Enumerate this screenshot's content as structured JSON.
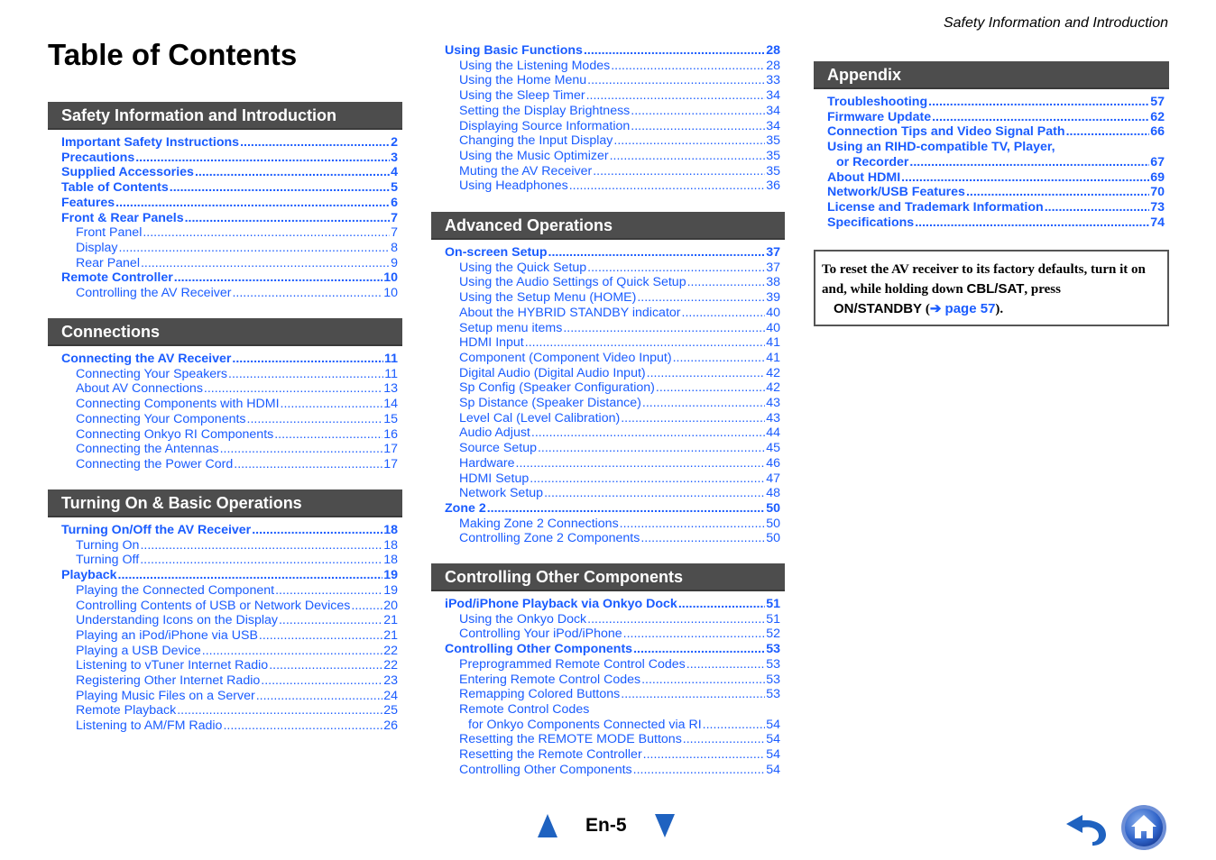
{
  "running_head": "Safety Information and Introduction",
  "page_title": "Table of Contents",
  "sections": [
    {
      "title": "Safety Information and Introduction",
      "items": [
        {
          "level": 1,
          "label": "Important Safety Instructions",
          "page": "2"
        },
        {
          "level": 1,
          "label": "Precautions",
          "page": "3"
        },
        {
          "level": 1,
          "label": "Supplied Accessories",
          "page": "4"
        },
        {
          "level": 1,
          "label": "Table of Contents",
          "page": "5"
        },
        {
          "level": 1,
          "label": "Features",
          "page": "6"
        },
        {
          "level": 1,
          "label": "Front & Rear Panels",
          "page": "7"
        },
        {
          "level": 2,
          "label": "Front Panel",
          "page": "7"
        },
        {
          "level": 2,
          "label": "Display",
          "page": "8"
        },
        {
          "level": 2,
          "label": "Rear Panel",
          "page": "9"
        },
        {
          "level": 1,
          "label": "Remote Controller",
          "page": "10"
        },
        {
          "level": 2,
          "label": "Controlling the AV Receiver",
          "page": "10"
        }
      ]
    },
    {
      "title": "Connections",
      "items": [
        {
          "level": 1,
          "label": "Connecting the AV Receiver",
          "page": "11"
        },
        {
          "level": 2,
          "label": "Connecting Your Speakers",
          "page": "11"
        },
        {
          "level": 2,
          "label": "About AV Connections",
          "page": "13"
        },
        {
          "level": 2,
          "label": "Connecting Components with HDMI",
          "page": "14"
        },
        {
          "level": 2,
          "label": "Connecting Your Components",
          "page": "15"
        },
        {
          "level": 2,
          "label": "Connecting Onkyo RI Components",
          "page": "16"
        },
        {
          "level": 2,
          "label": "Connecting the Antennas",
          "page": "17"
        },
        {
          "level": 2,
          "label": "Connecting the Power Cord",
          "page": "17"
        }
      ]
    },
    {
      "title": "Turning On & Basic Operations",
      "items": [
        {
          "level": 1,
          "label": "Turning On/Off the AV Receiver",
          "page": "18"
        },
        {
          "level": 2,
          "label": "Turning On",
          "page": "18"
        },
        {
          "level": 2,
          "label": "Turning Off",
          "page": "18"
        },
        {
          "level": 1,
          "label": "Playback",
          "page": "19"
        },
        {
          "level": 2,
          "label": "Playing the Connected Component",
          "page": "19"
        },
        {
          "level": 2,
          "label": "Controlling Contents of USB or Network Devices",
          "page": "20"
        },
        {
          "level": 2,
          "label": "Understanding Icons on the Display",
          "page": "21"
        },
        {
          "level": 2,
          "label": "Playing an iPod/iPhone via USB",
          "page": "21"
        },
        {
          "level": 2,
          "label": "Playing a USB Device",
          "page": "22"
        },
        {
          "level": 2,
          "label": "Listening to vTuner Internet Radio",
          "page": "22"
        },
        {
          "level": 2,
          "label": "Registering Other Internet Radio",
          "page": "23"
        },
        {
          "level": 2,
          "label": "Playing Music Files on a Server",
          "page": "24"
        },
        {
          "level": 2,
          "label": "Remote Playback",
          "page": "25"
        },
        {
          "level": 2,
          "label": "Listening to AM/FM Radio",
          "page": "26"
        }
      ]
    },
    {
      "title": "",
      "items": [
        {
          "level": 1,
          "label": "Using Basic Functions",
          "page": "28"
        },
        {
          "level": 2,
          "label": "Using the Listening Modes",
          "page": "28"
        },
        {
          "level": 2,
          "label": "Using the Home Menu",
          "page": "33"
        },
        {
          "level": 2,
          "label": "Using the Sleep Timer",
          "page": "34"
        },
        {
          "level": 2,
          "label": "Setting the Display Brightness",
          "page": "34"
        },
        {
          "level": 2,
          "label": "Displaying Source Information",
          "page": "34"
        },
        {
          "level": 2,
          "label": "Changing the Input Display",
          "page": "35"
        },
        {
          "level": 2,
          "label": "Using the Music Optimizer",
          "page": "35"
        },
        {
          "level": 2,
          "label": "Muting the AV Receiver",
          "page": "35"
        },
        {
          "level": 2,
          "label": "Using Headphones",
          "page": "36"
        }
      ]
    },
    {
      "title": "Advanced Operations",
      "items": [
        {
          "level": 1,
          "label": "On-screen Setup",
          "page": "37"
        },
        {
          "level": 2,
          "label": "Using the Quick Setup",
          "page": "37"
        },
        {
          "level": 2,
          "label": "Using the Audio Settings of Quick Setup",
          "page": "38"
        },
        {
          "level": 2,
          "label": "Using the Setup Menu (HOME)",
          "page": "39"
        },
        {
          "level": 2,
          "label": "About the HYBRID STANDBY indicator",
          "page": "40"
        },
        {
          "level": 2,
          "label": "Setup menu items",
          "page": "40"
        },
        {
          "level": 2,
          "label": "HDMI Input",
          "page": "41"
        },
        {
          "level": 2,
          "label": "Component (Component Video Input)",
          "page": "41"
        },
        {
          "level": 2,
          "label": "Digital Audio (Digital Audio Input)",
          "page": "42"
        },
        {
          "level": 2,
          "label": "Sp Config (Speaker Configuration)",
          "page": "42"
        },
        {
          "level": 2,
          "label": "Sp Distance (Speaker Distance)",
          "page": "43"
        },
        {
          "level": 2,
          "label": "Level Cal (Level Calibration)",
          "page": "43"
        },
        {
          "level": 2,
          "label": "Audio Adjust",
          "page": "44"
        },
        {
          "level": 2,
          "label": "Source Setup",
          "page": "45"
        },
        {
          "level": 2,
          "label": "Hardware",
          "page": "46"
        },
        {
          "level": 2,
          "label": "HDMI Setup",
          "page": "47"
        },
        {
          "level": 2,
          "label": "Network Setup",
          "page": "48"
        },
        {
          "level": 1,
          "label": "Zone 2",
          "page": "50"
        },
        {
          "level": 2,
          "label": "Making Zone 2 Connections",
          "page": "50"
        },
        {
          "level": 2,
          "label": "Controlling Zone 2 Components",
          "page": "50"
        }
      ]
    },
    {
      "title": "Controlling Other Components",
      "items": [
        {
          "level": 1,
          "label": "iPod/iPhone Playback via Onkyo Dock",
          "page": "51"
        },
        {
          "level": 2,
          "label": "Using the Onkyo Dock",
          "page": "51"
        },
        {
          "level": 2,
          "label": "Controlling Your iPod/iPhone",
          "page": "52"
        },
        {
          "level": 1,
          "label": "Controlling Other Components",
          "page": "53"
        },
        {
          "level": 2,
          "label": "Preprogrammed Remote Control Codes",
          "page": "53"
        },
        {
          "level": 2,
          "label": "Entering Remote Control Codes",
          "page": "53"
        },
        {
          "level": 2,
          "label": "Remapping Colored Buttons",
          "page": "53"
        },
        {
          "level": 2,
          "label": "Remote Control Codes",
          "page": ""
        },
        {
          "level": 3,
          "label": "for Onkyo Components Connected via RI",
          "page": "54"
        },
        {
          "level": 2,
          "label": "Resetting the REMOTE MODE Buttons",
          "page": "54"
        },
        {
          "level": 2,
          "label": "Resetting the Remote Controller",
          "page": "54"
        },
        {
          "level": 2,
          "label": "Controlling Other Components",
          "page": "54"
        }
      ]
    },
    {
      "title": "Appendix",
      "items": [
        {
          "level": 1,
          "label": "Troubleshooting",
          "page": "57"
        },
        {
          "level": 1,
          "label": "Firmware Update",
          "page": "62"
        },
        {
          "level": 1,
          "label": "Connection Tips and Video Signal Path",
          "page": "66"
        },
        {
          "level": 1,
          "label": "Using an RIHD-compatible TV, Player,",
          "page": ""
        },
        {
          "level": "1b",
          "label": "or Recorder",
          "page": "67"
        },
        {
          "level": 1,
          "label": "About HDMI",
          "page": "69"
        },
        {
          "level": 1,
          "label": "Network/USB Features",
          "page": "70"
        },
        {
          "level": 1,
          "label": "License and Trademark Information",
          "page": "73"
        },
        {
          "level": 1,
          "label": "Specifications",
          "page": "74"
        }
      ]
    }
  ],
  "note": {
    "text1": "To reset the AV receiver to its factory defaults, turn it on and, while holding down ",
    "key1": "CBL/SAT",
    "text2": ", press",
    "key2": "ON/STANDBY",
    "open": " (",
    "link": "➔ page 57",
    "close": ")."
  },
  "footer": {
    "page_number": "En-5",
    "prev_icon": "triangle-up-icon",
    "next_icon": "triangle-down-icon",
    "back_icon": "undo-arrow-icon",
    "home_icon": "home-icon"
  },
  "colors": {
    "link": "#1a5cff",
    "section_header_bg": "#4d4d4d",
    "nav_blue": "#1f62c0"
  }
}
